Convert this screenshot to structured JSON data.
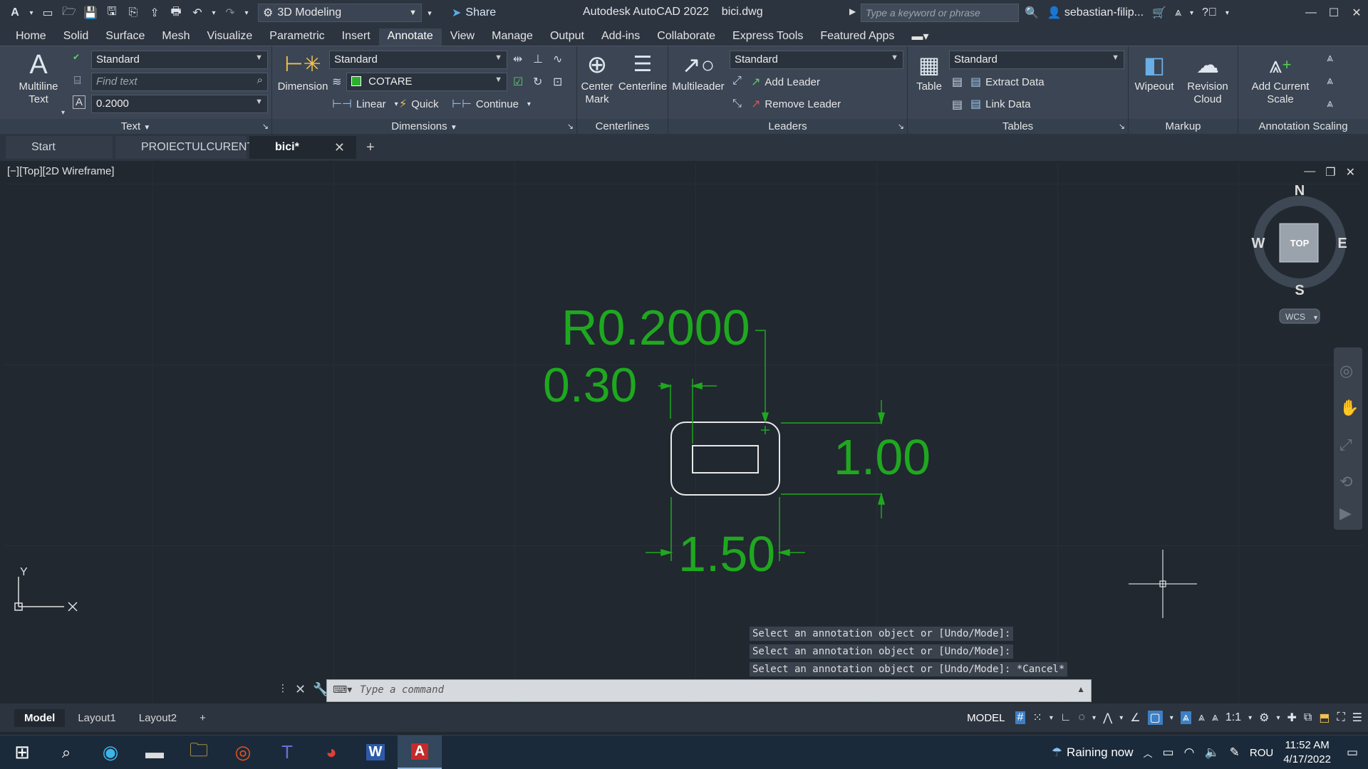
{
  "title_bar": {
    "workspace": "3D Modeling",
    "share_label": "Share",
    "app_title": "Autodesk AutoCAD 2022",
    "file_name": "bici.dwg",
    "search_placeholder": "Type a keyword or phrase",
    "user_name": "sebastian-filip..."
  },
  "menu_tabs": [
    "Home",
    "Solid",
    "Surface",
    "Mesh",
    "Visualize",
    "Parametric",
    "Insert",
    "Annotate",
    "View",
    "Manage",
    "Output",
    "Add-ins",
    "Collaborate",
    "Express Tools",
    "Featured Apps"
  ],
  "active_menu_tab": "Annotate",
  "ribbon": {
    "text_panel": {
      "multiline_text": "Multiline Text",
      "style": "Standard",
      "find_placeholder": "Find text",
      "height": "0.2000",
      "title": "Text"
    },
    "dimensions_panel": {
      "dimension": "Dimension",
      "style": "Standard",
      "layer": "COTARE",
      "linear": "Linear",
      "quick": "Quick",
      "continue": "Continue",
      "title": "Dimensions"
    },
    "centerlines_panel": {
      "center_mark": "Center Mark",
      "centerline": "Centerline",
      "title": "Centerlines"
    },
    "leaders_panel": {
      "multileader": "Multileader",
      "style": "Standard",
      "add_leader": "Add Leader",
      "remove_leader": "Remove Leader",
      "title": "Leaders"
    },
    "tables_panel": {
      "table": "Table",
      "style": "Standard",
      "extract_data": "Extract Data",
      "link_data": "Link Data",
      "title": "Tables"
    },
    "markup_panel": {
      "wipeout": "Wipeout",
      "revision_cloud": "Revision Cloud",
      "title": "Markup"
    },
    "annotation_scaling_panel": {
      "add_current_scale": "Add Current Scale",
      "title": "Annotation Scaling"
    }
  },
  "file_tabs": [
    {
      "label": "Start",
      "closable": false
    },
    {
      "label": "PROIECTULCURENT*",
      "closable": true
    },
    {
      "label": "bici*",
      "closable": true,
      "active": true
    }
  ],
  "viewport": {
    "label": "[−][Top][2D Wireframe]",
    "viewcube": {
      "n": "N",
      "s": "S",
      "e": "E",
      "w": "W",
      "top": "TOP",
      "wcs": "WCS"
    },
    "ucs_y": "Y",
    "dimensions": {
      "radius": "R0.2000",
      "offset": "0.30",
      "height": "1.00",
      "width": "1.50"
    },
    "command_history": [
      "Select an annotation object or [Undo/Mode]:",
      "Select an annotation object or [Undo/Mode]:",
      "Select an annotation object or [Undo/Mode]: *Cancel*"
    ],
    "command_placeholder": "Type a command"
  },
  "layout_tabs": [
    "Model",
    "Layout1",
    "Layout2"
  ],
  "active_layout": "Model",
  "status_bar": {
    "mode": "MODEL",
    "scale": "1:1"
  },
  "taskbar": {
    "weather": "Raining now",
    "language": "ROU",
    "time": "11:52 AM",
    "date": "4/17/2022"
  },
  "colors": {
    "dimension_green": "#1fa81f",
    "canvas_bg": "#212830",
    "ribbon_bg": "#3b4554",
    "accent_blue": "#3d7fc4"
  }
}
